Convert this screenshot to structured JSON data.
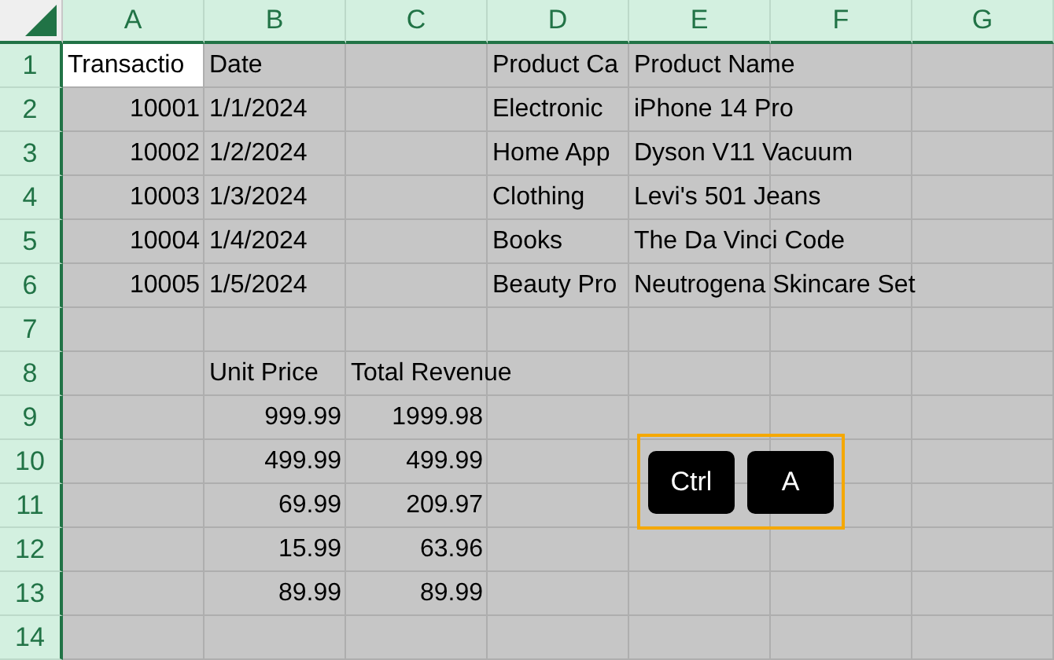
{
  "columns": [
    "A",
    "B",
    "C",
    "D",
    "E",
    "F",
    "G"
  ],
  "rows": [
    {
      "label": "1",
      "cells": {
        "A": {
          "text": "Transactio",
          "kind": "text",
          "active": true
        },
        "B": {
          "text": "Date",
          "kind": "text",
          "active": false
        },
        "D": {
          "text": "Product Ca",
          "kind": "text",
          "active": false
        },
        "E": {
          "text": "Product Name",
          "kind": "text",
          "active": false
        }
      }
    },
    {
      "label": "2",
      "cells": {
        "A": {
          "text": "10001",
          "kind": "number",
          "active": false
        },
        "B": {
          "text": "1/1/2024",
          "kind": "text",
          "active": false
        },
        "D": {
          "text": "Electronic",
          "kind": "text",
          "active": false
        },
        "E": {
          "text": "iPhone 14 Pro",
          "kind": "text",
          "active": false
        }
      }
    },
    {
      "label": "3",
      "cells": {
        "A": {
          "text": "10002",
          "kind": "number",
          "active": false
        },
        "B": {
          "text": "1/2/2024",
          "kind": "text",
          "active": false
        },
        "D": {
          "text": "Home App",
          "kind": "text",
          "active": false
        },
        "E": {
          "text": "Dyson V11 Vacuum",
          "kind": "text",
          "active": false
        }
      }
    },
    {
      "label": "4",
      "cells": {
        "A": {
          "text": "10003",
          "kind": "number",
          "active": false
        },
        "B": {
          "text": "1/3/2024",
          "kind": "text",
          "active": false
        },
        "D": {
          "text": "Clothing",
          "kind": "text",
          "active": false
        },
        "E": {
          "text": "Levi's 501 Jeans",
          "kind": "text",
          "active": false
        }
      }
    },
    {
      "label": "5",
      "cells": {
        "A": {
          "text": "10004",
          "kind": "number",
          "active": false
        },
        "B": {
          "text": "1/4/2024",
          "kind": "text",
          "active": false
        },
        "D": {
          "text": "Books",
          "kind": "text",
          "active": false
        },
        "E": {
          "text": "The Da Vinci Code",
          "kind": "text",
          "active": false
        }
      }
    },
    {
      "label": "6",
      "cells": {
        "A": {
          "text": "10005",
          "kind": "number",
          "active": false
        },
        "B": {
          "text": "1/5/2024",
          "kind": "text",
          "active": false
        },
        "D": {
          "text": "Beauty Pro",
          "kind": "text",
          "active": false
        },
        "E": {
          "text": "Neutrogena Skincare Set",
          "kind": "text",
          "active": false
        }
      }
    },
    {
      "label": "7",
      "cells": {}
    },
    {
      "label": "8",
      "cells": {
        "B": {
          "text": "Unit Price",
          "kind": "text",
          "active": false
        },
        "C": {
          "text": "Total Revenue",
          "kind": "text",
          "active": false
        }
      }
    },
    {
      "label": "9",
      "cells": {
        "B": {
          "text": "999.99",
          "kind": "number",
          "active": false
        },
        "C": {
          "text": "1999.98",
          "kind": "number",
          "active": false
        }
      }
    },
    {
      "label": "10",
      "cells": {
        "B": {
          "text": "499.99",
          "kind": "number",
          "active": false
        },
        "C": {
          "text": "499.99",
          "kind": "number",
          "active": false
        }
      }
    },
    {
      "label": "11",
      "cells": {
        "B": {
          "text": "69.99",
          "kind": "number",
          "active": false
        },
        "C": {
          "text": "209.97",
          "kind": "number",
          "active": false
        }
      }
    },
    {
      "label": "12",
      "cells": {
        "B": {
          "text": "15.99",
          "kind": "number",
          "active": false
        },
        "C": {
          "text": "63.96",
          "kind": "number",
          "active": false
        }
      }
    },
    {
      "label": "13",
      "cells": {
        "B": {
          "text": "89.99",
          "kind": "number",
          "active": false
        },
        "C": {
          "text": "89.99",
          "kind": "number",
          "active": false
        }
      }
    },
    {
      "label": "14",
      "cells": {}
    }
  ],
  "shortcut_keys": [
    "Ctrl",
    "A"
  ]
}
